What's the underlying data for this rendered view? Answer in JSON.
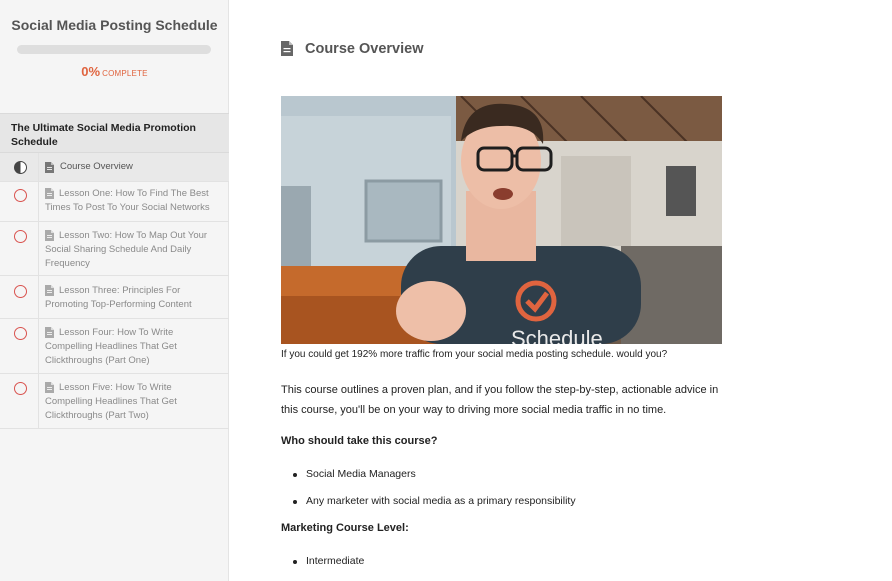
{
  "sidebar": {
    "course_title": "Social Media Posting Schedule",
    "progress": {
      "percent": 0,
      "percent_label": "0%",
      "complete_label": "COMPLETE"
    },
    "section_title": "The Ultimate Social Media Promotion Schedule",
    "lessons": [
      {
        "label": "Course Overview",
        "status": "in-progress"
      },
      {
        "label": "Lesson One: How To Find The Best Times To Post To Your Social Networks",
        "status": "not-started"
      },
      {
        "label": "Lesson Two: How To Map Out Your Social Sharing Schedule And Daily Frequency",
        "status": "not-started"
      },
      {
        "label": "Lesson Three: Principles For Promoting Top-Performing Content",
        "status": "not-started"
      },
      {
        "label": "Lesson Four: How To Write Compelling Headlines That Get Clickthroughs (Part One)",
        "status": "not-started"
      },
      {
        "label": "Lesson Five: How To Write Compelling Headlines That Get Clickthroughs (Part Two)",
        "status": "not-started"
      }
    ]
  },
  "main": {
    "title": "Course Overview",
    "video": {
      "shirt_text": "Schedule"
    },
    "caption": "If you could get 192% more traffic from your social media posting schedule. would you?",
    "intro": "This course outlines a proven plan, and if you follow the step-by-step, actionable advice in this course, you'll be on your way to driving more social media traffic in no time.",
    "who_heading": "Who should take this course?",
    "who_items": [
      "Social Media Managers",
      "Any marketer with social media as a primary responsibility"
    ],
    "level_heading": "Marketing Course Level:",
    "level_items": [
      "Intermediate"
    ]
  },
  "colors": {
    "accent": "#e0643f",
    "incomplete": "#d9534f"
  }
}
